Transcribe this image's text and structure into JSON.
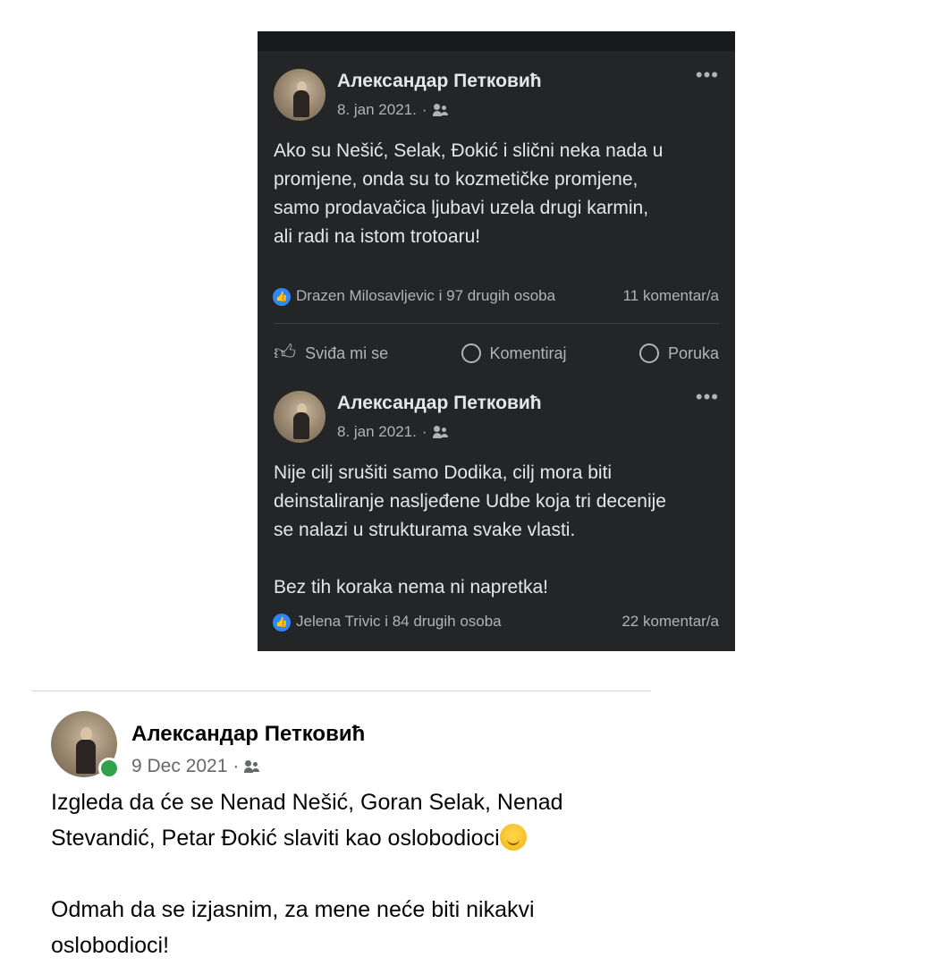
{
  "posts_dark": [
    {
      "author": "Александар Петковић",
      "date": "8. jan 2021.",
      "separator": "·",
      "more": "•••",
      "text": "Ako su Nešić, Selak, Đokić i slični neka nada u\npromjene, onda su to kozmetičke promjene,\nsamo prodavačica ljubavi uzela drugi karmin,\nali radi na istom trotoaru!",
      "reactions": "Drazen Milosavljevic i 97 drugih osoba",
      "comments": "11 komentar/a",
      "actions": {
        "like": "Sviđa mi se",
        "comment": "Komentiraj",
        "message": "Poruka"
      }
    },
    {
      "author": "Александар Петковић",
      "date": "8. jan 2021.",
      "separator": "·",
      "more": "•••",
      "text": "Nije cilj srušiti samo Dodika, cilj mora biti\ndeinstaliranje naslјeđene Udbe koja tri decenije\nse nalazi u strukturama svake vlasti.\n\nBez tih koraka nema ni napretka!",
      "reactions": "Jelena Trivic i 84 drugih osoba",
      "comments": "22 komentar/a"
    }
  ],
  "post_light": {
    "author": "Александар Петковић",
    "date": "9 Dec 2021",
    "separator": "·",
    "text_line1": "Izgleda da će se Nenad Nešić, Goran Selak, Nenad\nStevandić, Petar Đokić slaviti kao oslobodioci",
    "text_line2": "\n\nOdmah da se izjasnim, za mene neće biti nikakvi\noslobodioci!"
  },
  "colors": {
    "dark_bg": "#242526",
    "accent_blue": "#2d88ff",
    "online_green": "#31a24c"
  }
}
